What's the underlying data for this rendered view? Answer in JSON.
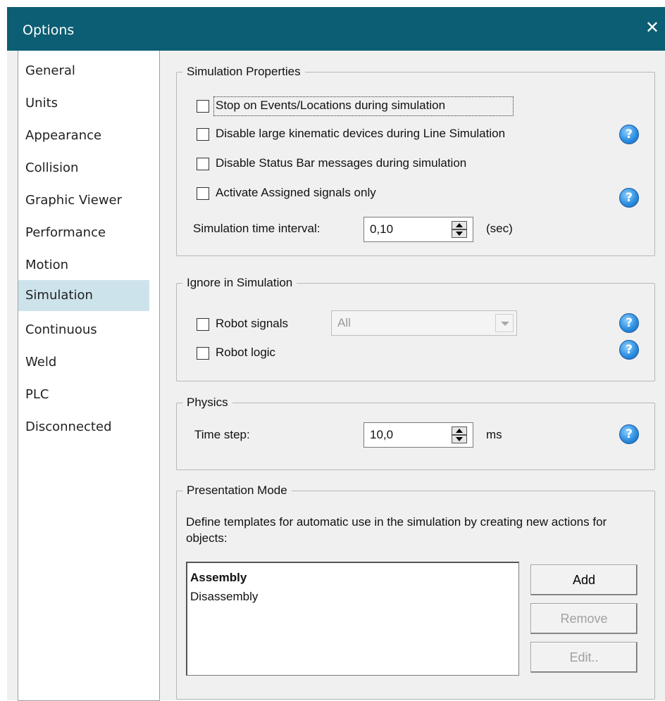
{
  "window": {
    "title": "Options",
    "close_glyph": "✕"
  },
  "nav": {
    "items": [
      {
        "label": "General"
      },
      {
        "label": "Units"
      },
      {
        "label": "Appearance"
      },
      {
        "label": "Collision"
      },
      {
        "label": "Graphic Viewer"
      },
      {
        "label": "Performance"
      },
      {
        "label": "Motion"
      },
      {
        "label": "Simulation",
        "selected": true
      },
      {
        "label": "Continuous"
      },
      {
        "label": "Weld"
      },
      {
        "label": "PLC"
      },
      {
        "label": "Disconnected"
      }
    ]
  },
  "simulation_properties": {
    "legend": "Simulation Properties",
    "checkboxes": [
      {
        "label": "Stop on Events/Locations during simulation",
        "checked": false
      },
      {
        "label": "Disable large kinematic devices during Line Simulation",
        "checked": false
      },
      {
        "label": "Disable Status Bar messages during simulation",
        "checked": false
      },
      {
        "label": "Activate Assigned signals only",
        "checked": false
      }
    ],
    "interval_label": "Simulation time interval:",
    "interval_value": "0,10",
    "interval_unit": "(sec)"
  },
  "ignore": {
    "legend": "Ignore in Simulation",
    "robot_signals_label": "Robot signals",
    "robot_signals_checked": false,
    "robot_signals_combo": "All",
    "robot_logic_label": "Robot logic",
    "robot_logic_checked": false
  },
  "physics": {
    "legend": "Physics",
    "time_step_label": "Time step:",
    "time_step_value": "10,0",
    "time_step_unit": "ms"
  },
  "presentation": {
    "legend": "Presentation Mode",
    "description": "Define templates for automatic use in the simulation by creating new actions for objects:",
    "templates": [
      "Assembly",
      "Disassembly"
    ],
    "add_label": "Add",
    "remove_label": "Remove",
    "edit_label": "Edit.."
  },
  "help_glyph": "?",
  "colors": {
    "titlebar": "#0b5e73",
    "nav_selected": "#cde3ec",
    "dialog_bg": "#f0f0f0",
    "help_icon": "#2e8fe0"
  }
}
